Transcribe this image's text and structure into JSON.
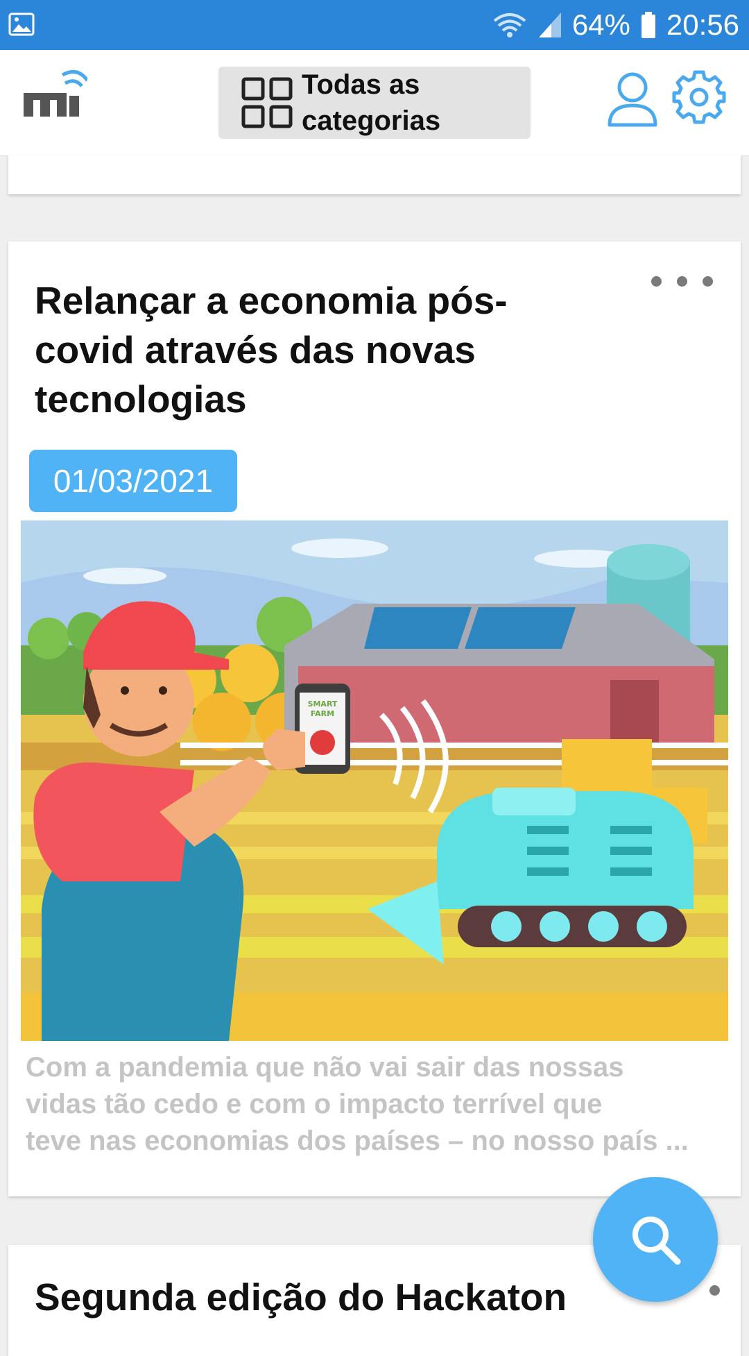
{
  "status_bar": {
    "battery": "64%",
    "time": "20:56",
    "icons": [
      "gallery-icon",
      "wifi-icon",
      "signal-icon",
      "battery-icon"
    ]
  },
  "app_bar": {
    "category_button_label": "Todas as categorias",
    "icons": [
      "app-logo",
      "grid-icon",
      "user-icon",
      "gear-icon"
    ]
  },
  "articles": [
    {
      "title": "Relançar a economia pós-covid através das novas tecnologias",
      "date": "01/03/2021",
      "image_alt": "Smart farm illustration",
      "image_text": "SMART FARM",
      "excerpt_lines": [
        "Com a pandemia que não vai sair das nossas",
        "vidas tão cedo e com o impacto terrível que",
        "teve nas economias dos países – no nosso país ..."
      ]
    },
    {
      "title": "Segunda edição do Hackaton"
    }
  ],
  "fab": {
    "icon": "search-icon"
  },
  "colors": {
    "status_bar": "#2b86d9",
    "accent": "#4fb3f6",
    "icon_blue": "#4aa9ee"
  }
}
